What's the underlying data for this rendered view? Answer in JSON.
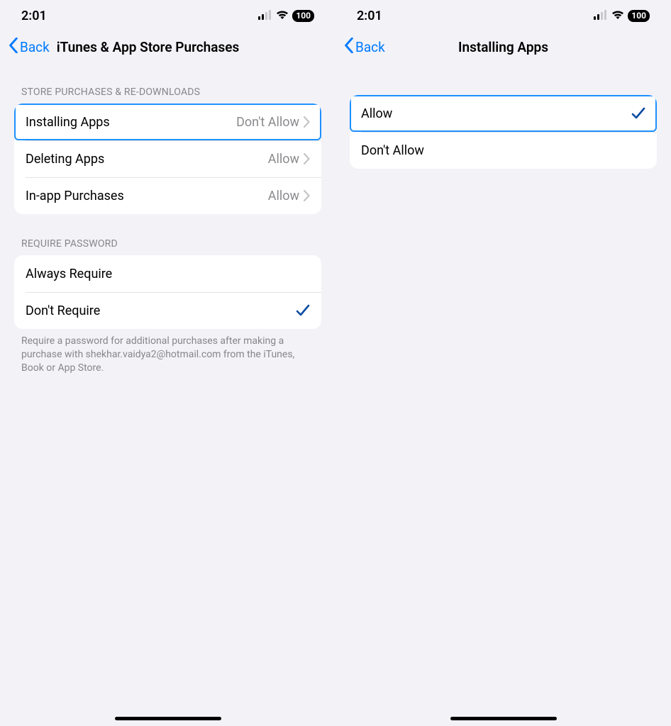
{
  "statusBar": {
    "time": "2:01",
    "battery": "100"
  },
  "left": {
    "back": "Back",
    "title": "iTunes & App Store Purchases",
    "section1Header": "STORE PURCHASES & RE-DOWNLOADS",
    "rows1": [
      {
        "label": "Installing Apps",
        "value": "Don't Allow"
      },
      {
        "label": "Deleting Apps",
        "value": "Allow"
      },
      {
        "label": "In-app Purchases",
        "value": "Allow"
      }
    ],
    "section2Header": "REQUIRE PASSWORD",
    "rows2": [
      {
        "label": "Always Require"
      },
      {
        "label": "Don't Require"
      }
    ],
    "footer": "Require a password for additional purchases after making a purchase with shekhar.vaidya2@hotmail.com from the iTunes, Book or App Store."
  },
  "right": {
    "back": "Back",
    "title": "Installing Apps",
    "rows": [
      {
        "label": "Allow"
      },
      {
        "label": "Don't Allow"
      }
    ]
  }
}
